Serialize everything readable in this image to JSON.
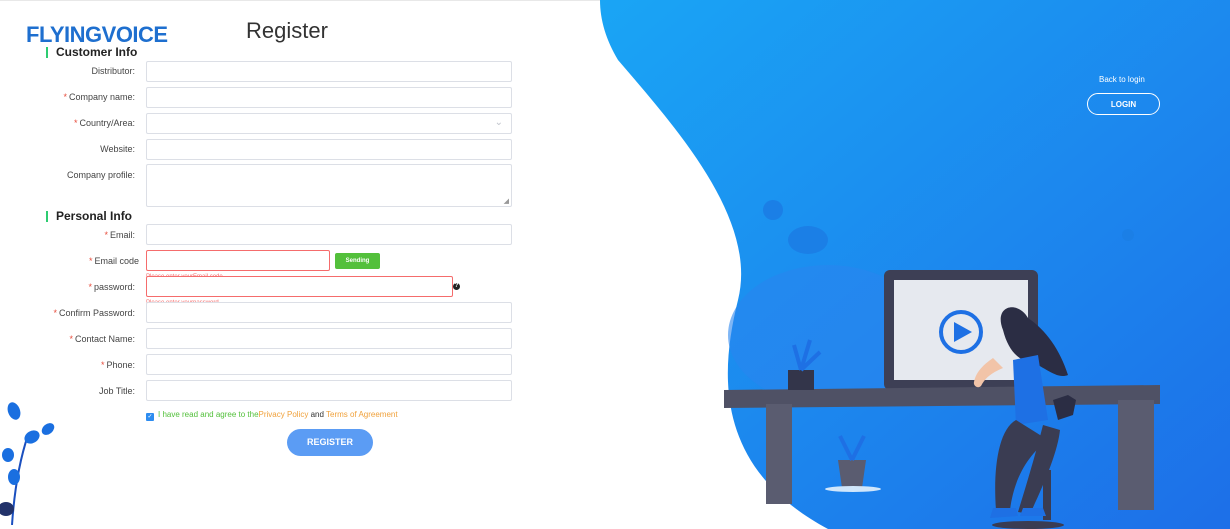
{
  "header": {
    "logo": "FLYINGVOICE",
    "title": "Register"
  },
  "sections": {
    "customer": "Customer Info",
    "personal": "Personal Info"
  },
  "fields": {
    "distributor": {
      "label": "Distributor:",
      "required": false,
      "value": ""
    },
    "company_name": {
      "label": "Company name:",
      "required": true,
      "value": ""
    },
    "country": {
      "label": "Country/Area:",
      "required": true,
      "value": ""
    },
    "website": {
      "label": "Website:",
      "required": false,
      "value": ""
    },
    "company_profile": {
      "label": "Company profile:",
      "required": false,
      "value": ""
    },
    "email": {
      "label": "Email:",
      "required": true,
      "value": ""
    },
    "email_code": {
      "label": "Email code",
      "required": true,
      "value": "",
      "error": "Please enter yourEmail code"
    },
    "password": {
      "label": "password:",
      "required": true,
      "value": "",
      "error": "Please enter yourpassword"
    },
    "confirm_password": {
      "label": "Confirm Password:",
      "required": true,
      "value": ""
    },
    "contact_name": {
      "label": "Contact Name:",
      "required": true,
      "value": ""
    },
    "phone": {
      "label": "Phone:",
      "required": true,
      "value": ""
    },
    "job_title": {
      "label": "Job Title:",
      "required": false,
      "value": ""
    }
  },
  "send_button": "Sending",
  "help_icon": "?",
  "agreement": {
    "checked": true,
    "text": "I have read and agree to the",
    "privacy": "Privacy Policy",
    "and": "and",
    "terms": "Terms of Agreement"
  },
  "register_button": "REGISTER",
  "right_panel": {
    "back_text": "Back to login",
    "login_button": "LOGIN"
  },
  "colors": {
    "blue": "#1f8cf0",
    "green": "#53c03b",
    "required": "#e74c3c",
    "error": "#f56c6c",
    "link": "#f0a13b"
  }
}
